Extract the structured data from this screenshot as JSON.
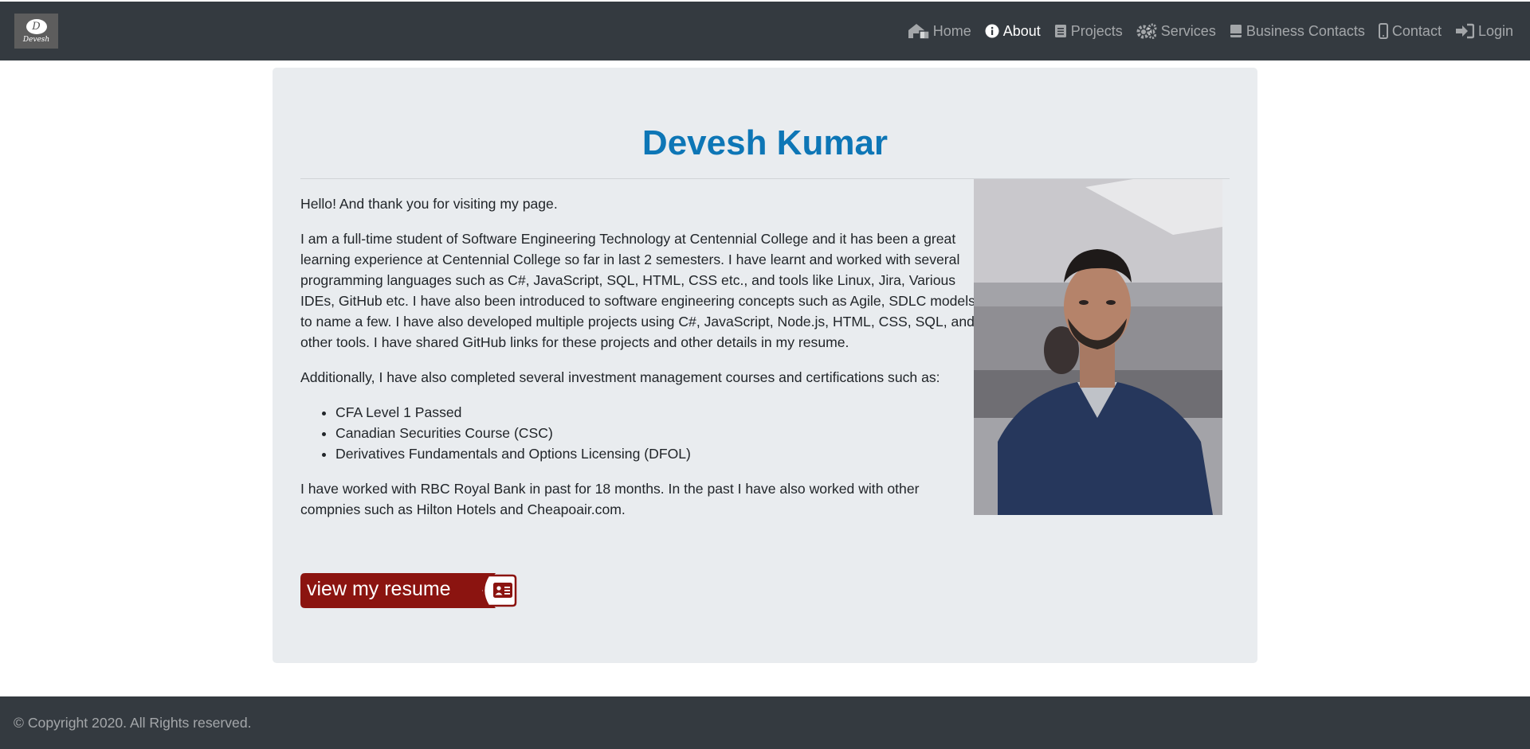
{
  "navbar": {
    "brand_text": "Devesh",
    "brand_initial": "D",
    "items": [
      {
        "label": "Home",
        "icon": "home-icon",
        "active": false
      },
      {
        "label": "About",
        "icon": "info-icon",
        "active": true
      },
      {
        "label": "Projects",
        "icon": "projects-icon",
        "active": false
      },
      {
        "label": "Services",
        "icon": "gears-icon",
        "active": false
      },
      {
        "label": "Business Contacts",
        "icon": "address-book-icon",
        "active": false
      },
      {
        "label": "Contact",
        "icon": "mobile-icon",
        "active": false
      },
      {
        "label": "Login",
        "icon": "sign-in-icon",
        "active": false
      }
    ]
  },
  "main": {
    "title": "Devesh Kumar",
    "intro": "Hello! And thank you for visiting my page.",
    "paragraph1": "I am a full-time student of Software Engineering Technology at Centennial College and it has been a great learning experience at Centennial College so far in last 2 semesters. I have learnt and worked with several programming languages such as C#, JavaScript, SQL, HTML, CSS etc., and tools like Linux, Jira, Various IDEs, GitHub etc. I have also been introduced to software engineering concepts such as Agile, SDLC models to name a few. I have also developed multiple projects using C#, JavaScript, Node.js, HTML, CSS, SQL, and other tools. I have shared GitHub links for these projects and other details in my resume.",
    "paragraph2": "Additionally, I have also completed several investment management courses and certifications such as:",
    "certifications": [
      "CFA Level 1 Passed",
      "Canadian Securities Course (CSC)",
      "Derivatives Fundamentals and Options Licensing (DFOL)"
    ],
    "paragraph3": "I have worked with RBC Royal Bank in past for 18 months. In the past I have also worked with other compnies such as Hilton Hotels and Cheapoair.com.",
    "resume_button": "view my resume"
  },
  "footer": {
    "copyright": "© Copyright 2020. All Rights reserved."
  },
  "colors": {
    "navbar_bg": "#343a40",
    "title": "#0d76b6",
    "jumbotron_bg": "#e9ecef",
    "resume_button": "#8b1410"
  }
}
